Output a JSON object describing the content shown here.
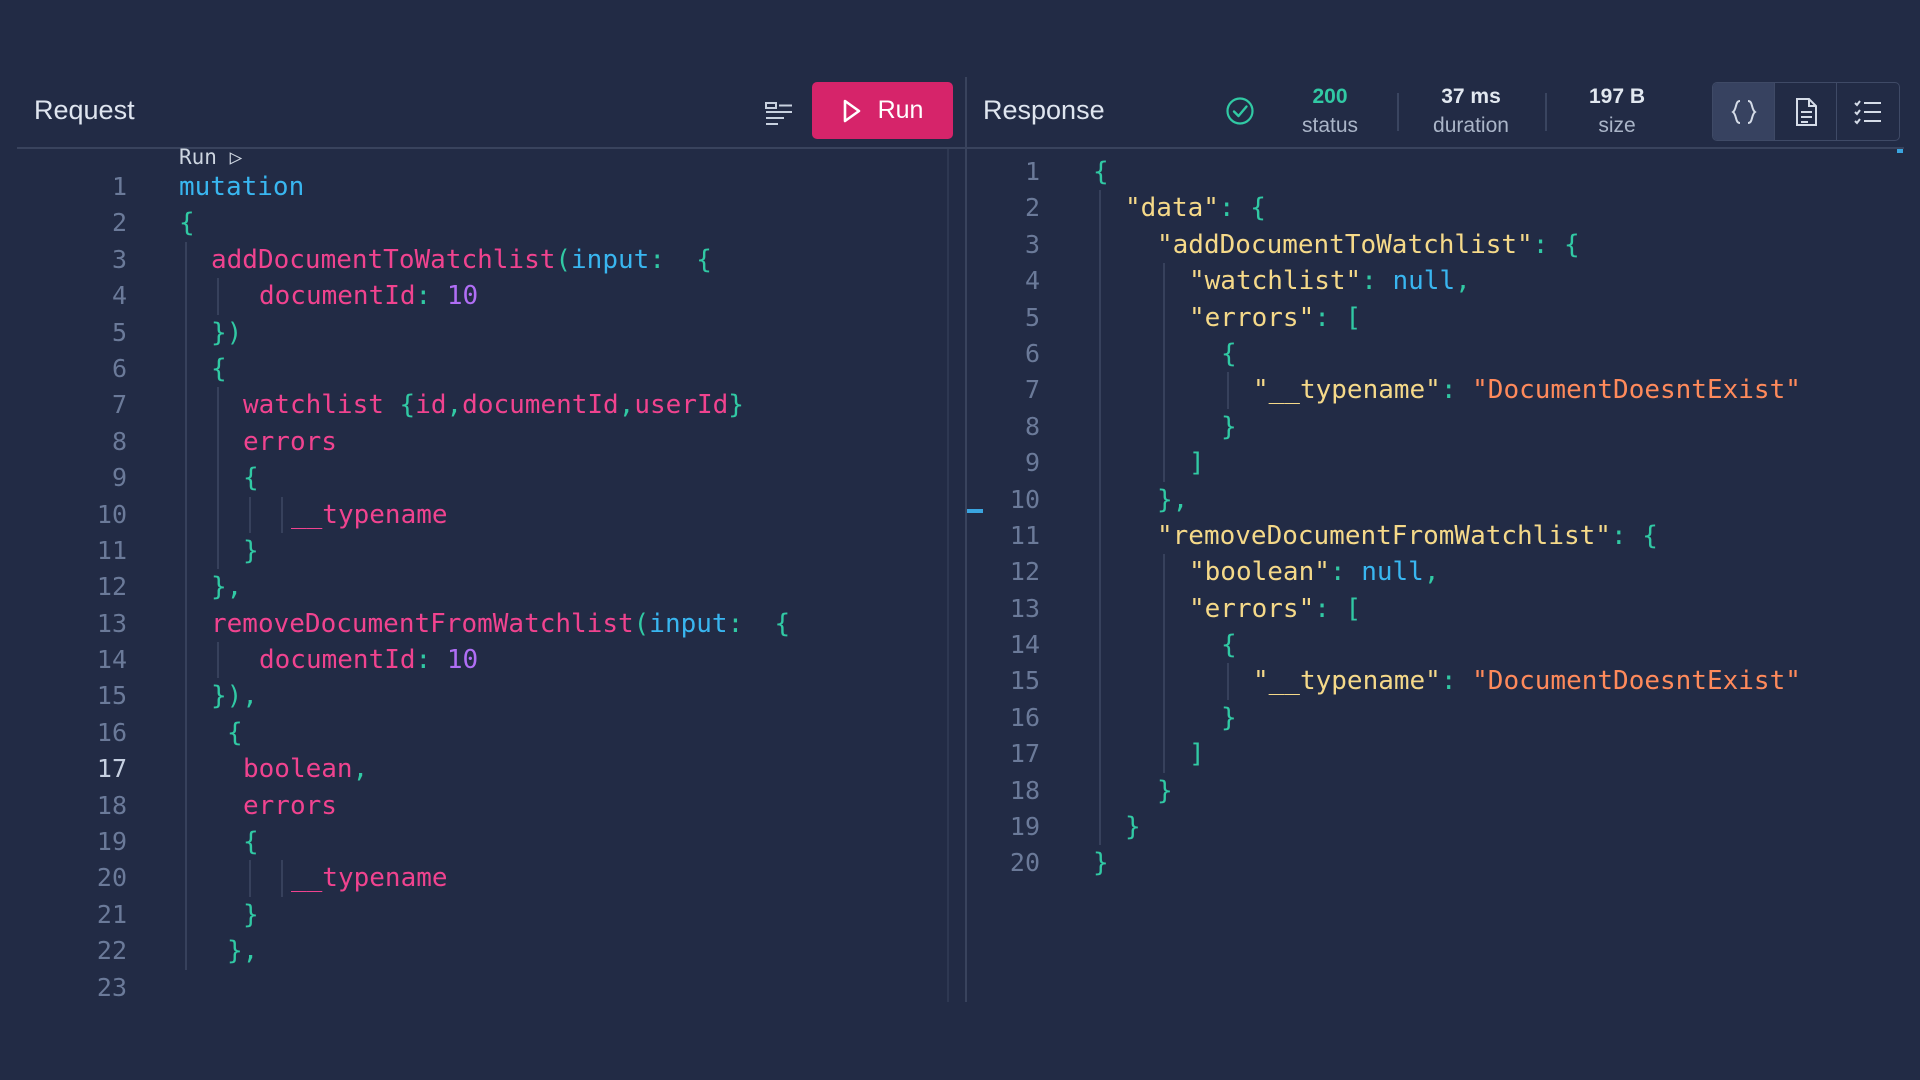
{
  "request": {
    "title": "Request",
    "run_label": "Run",
    "codelens": "Run ▷",
    "active_line": 17,
    "line_count": 23,
    "lines": [
      {
        "indent": 0,
        "guides": [],
        "tokens": [
          {
            "t": "mutation",
            "c": "kw"
          }
        ]
      },
      {
        "indent": 0,
        "guides": [],
        "tokens": [
          {
            "t": "{",
            "c": "pun"
          }
        ]
      },
      {
        "indent": 1,
        "guides": [
          0
        ],
        "tokens": [
          {
            "t": "addDocumentToWatchlist",
            "c": "fld"
          },
          {
            "t": "(",
            "c": "pun"
          },
          {
            "t": "input",
            "c": "kw"
          },
          {
            "t": ":  ",
            "c": "pun"
          },
          {
            "t": "{",
            "c": "pun"
          }
        ]
      },
      {
        "indent": 2.5,
        "guides": [
          0,
          1
        ],
        "tokens": [
          {
            "t": "documentId",
            "c": "fld"
          },
          {
            "t": ": ",
            "c": "pun"
          },
          {
            "t": "10",
            "c": "num"
          }
        ]
      },
      {
        "indent": 1,
        "guides": [
          0
        ],
        "tokens": [
          {
            "t": "})",
            "c": "pun"
          }
        ]
      },
      {
        "indent": 1,
        "guides": [
          0
        ],
        "tokens": [
          {
            "t": "{",
            "c": "pun"
          }
        ]
      },
      {
        "indent": 2,
        "guides": [
          0,
          1
        ],
        "tokens": [
          {
            "t": "watchlist ",
            "c": "fld"
          },
          {
            "t": "{",
            "c": "pun"
          },
          {
            "t": "id",
            "c": "fld"
          },
          {
            "t": ",",
            "c": "pun"
          },
          {
            "t": "documentId",
            "c": "fld"
          },
          {
            "t": ",",
            "c": "pun"
          },
          {
            "t": "userId",
            "c": "fld"
          },
          {
            "t": "}",
            "c": "pun"
          }
        ]
      },
      {
        "indent": 2,
        "guides": [
          0,
          1
        ],
        "tokens": [
          {
            "t": "errors",
            "c": "fld"
          }
        ]
      },
      {
        "indent": 2,
        "guides": [
          0,
          1
        ],
        "tokens": [
          {
            "t": "{",
            "c": "pun"
          }
        ]
      },
      {
        "indent": 3.5,
        "guides": [
          0,
          1,
          2,
          3
        ],
        "tokens": [
          {
            "t": "__typename",
            "c": "fld"
          }
        ]
      },
      {
        "indent": 2,
        "guides": [
          0,
          1
        ],
        "tokens": [
          {
            "t": "}",
            "c": "pun"
          }
        ]
      },
      {
        "indent": 1,
        "guides": [
          0
        ],
        "tokens": [
          {
            "t": "},",
            "c": "pun"
          }
        ]
      },
      {
        "indent": 1,
        "guides": [
          0
        ],
        "tokens": [
          {
            "t": "removeDocumentFromWatchlist",
            "c": "fld"
          },
          {
            "t": "(",
            "c": "pun"
          },
          {
            "t": "input",
            "c": "kw"
          },
          {
            "t": ":  ",
            "c": "pun"
          },
          {
            "t": "{",
            "c": "pun"
          }
        ]
      },
      {
        "indent": 2.5,
        "guides": [
          0,
          1
        ],
        "tokens": [
          {
            "t": "documentId",
            "c": "fld"
          },
          {
            "t": ": ",
            "c": "pun"
          },
          {
            "t": "10",
            "c": "num"
          }
        ]
      },
      {
        "indent": 1,
        "guides": [
          0
        ],
        "tokens": [
          {
            "t": "}),",
            "c": "pun"
          }
        ]
      },
      {
        "indent": 1.5,
        "guides": [
          0
        ],
        "tokens": [
          {
            "t": "{",
            "c": "pun"
          }
        ]
      },
      {
        "indent": 2,
        "guides": [
          0
        ],
        "tokens": [
          {
            "t": "boolean",
            "c": "fld"
          },
          {
            "t": ",",
            "c": "pun"
          }
        ]
      },
      {
        "indent": 2,
        "guides": [
          0
        ],
        "tokens": [
          {
            "t": "errors",
            "c": "fld"
          }
        ]
      },
      {
        "indent": 2,
        "guides": [
          0
        ],
        "tokens": [
          {
            "t": "{",
            "c": "pun"
          }
        ]
      },
      {
        "indent": 3.5,
        "guides": [
          0,
          2,
          3
        ],
        "tokens": [
          {
            "t": "__typename",
            "c": "fld"
          }
        ]
      },
      {
        "indent": 2,
        "guides": [
          0
        ],
        "tokens": [
          {
            "t": "}",
            "c": "pun"
          }
        ]
      },
      {
        "indent": 1.5,
        "guides": [
          0
        ],
        "tokens": [
          {
            "t": "},",
            "c": "pun"
          }
        ]
      },
      {
        "indent": 0,
        "guides": [],
        "tokens": []
      }
    ]
  },
  "response": {
    "title": "Response",
    "status_value": "200",
    "status_label": "status",
    "duration_value": "37 ms",
    "duration_label": "duration",
    "size_value": "197 B",
    "size_label": "size",
    "status_color": "#31c9a4",
    "view_modes": [
      "json-icon",
      "document-icon",
      "list-icon"
    ],
    "active_view": 0,
    "line_count": 20,
    "lines": [
      {
        "indent": 0,
        "guides": [],
        "tokens": [
          {
            "t": "{",
            "c": "br"
          }
        ]
      },
      {
        "indent": 1,
        "guides": [
          0
        ],
        "tokens": [
          {
            "t": "\"data\"",
            "c": "key"
          },
          {
            "t": ": ",
            "c": "pun"
          },
          {
            "t": "{",
            "c": "br"
          }
        ]
      },
      {
        "indent": 2,
        "guides": [
          0
        ],
        "tokens": [
          {
            "t": "\"addDocumentToWatchlist\"",
            "c": "key"
          },
          {
            "t": ": ",
            "c": "pun"
          },
          {
            "t": "{",
            "c": "br"
          }
        ]
      },
      {
        "indent": 3,
        "guides": [
          0,
          2
        ],
        "tokens": [
          {
            "t": "\"watchlist\"",
            "c": "key"
          },
          {
            "t": ": ",
            "c": "pun"
          },
          {
            "t": "null",
            "c": "nul"
          },
          {
            "t": ",",
            "c": "pun"
          }
        ]
      },
      {
        "indent": 3,
        "guides": [
          0,
          2
        ],
        "tokens": [
          {
            "t": "\"errors\"",
            "c": "key"
          },
          {
            "t": ": ",
            "c": "pun"
          },
          {
            "t": "[",
            "c": "br"
          }
        ]
      },
      {
        "indent": 4,
        "guides": [
          0,
          2
        ],
        "tokens": [
          {
            "t": "{",
            "c": "br"
          }
        ]
      },
      {
        "indent": 5,
        "guides": [
          0,
          2,
          4
        ],
        "tokens": [
          {
            "t": "\"__typename\"",
            "c": "key"
          },
          {
            "t": ": ",
            "c": "pun"
          },
          {
            "t": "\"DocumentDoesntExist\"",
            "c": "str"
          }
        ]
      },
      {
        "indent": 4,
        "guides": [
          0,
          2
        ],
        "tokens": [
          {
            "t": "}",
            "c": "br"
          }
        ]
      },
      {
        "indent": 3,
        "guides": [
          0,
          2
        ],
        "tokens": [
          {
            "t": "]",
            "c": "br"
          }
        ]
      },
      {
        "indent": 2,
        "guides": [
          0
        ],
        "tokens": [
          {
            "t": "},",
            "c": "br"
          }
        ]
      },
      {
        "indent": 2,
        "guides": [
          0
        ],
        "tokens": [
          {
            "t": "\"removeDocumentFromWatchlist\"",
            "c": "key"
          },
          {
            "t": ": ",
            "c": "pun"
          },
          {
            "t": "{",
            "c": "br"
          }
        ]
      },
      {
        "indent": 3,
        "guides": [
          0,
          2
        ],
        "tokens": [
          {
            "t": "\"boolean\"",
            "c": "key"
          },
          {
            "t": ": ",
            "c": "pun"
          },
          {
            "t": "null",
            "c": "nul"
          },
          {
            "t": ",",
            "c": "pun"
          }
        ]
      },
      {
        "indent": 3,
        "guides": [
          0,
          2
        ],
        "tokens": [
          {
            "t": "\"errors\"",
            "c": "key"
          },
          {
            "t": ": ",
            "c": "pun"
          },
          {
            "t": "[",
            "c": "br"
          }
        ]
      },
      {
        "indent": 4,
        "guides": [
          0,
          2
        ],
        "tokens": [
          {
            "t": "{",
            "c": "br"
          }
        ]
      },
      {
        "indent": 5,
        "guides": [
          0,
          2,
          4
        ],
        "tokens": [
          {
            "t": "\"__typename\"",
            "c": "key"
          },
          {
            "t": ": ",
            "c": "pun"
          },
          {
            "t": "\"DocumentDoesntExist\"",
            "c": "str"
          }
        ]
      },
      {
        "indent": 4,
        "guides": [
          0,
          2
        ],
        "tokens": [
          {
            "t": "}",
            "c": "br"
          }
        ]
      },
      {
        "indent": 3,
        "guides": [
          0,
          2
        ],
        "tokens": [
          {
            "t": "]",
            "c": "br"
          }
        ]
      },
      {
        "indent": 2,
        "guides": [
          0
        ],
        "tokens": [
          {
            "t": "}",
            "c": "br"
          }
        ]
      },
      {
        "indent": 1,
        "guides": [
          0
        ],
        "tokens": [
          {
            "t": "}",
            "c": "br"
          }
        ]
      },
      {
        "indent": 0,
        "guides": [],
        "tokens": [
          {
            "t": "}",
            "c": "br"
          }
        ]
      }
    ]
  }
}
